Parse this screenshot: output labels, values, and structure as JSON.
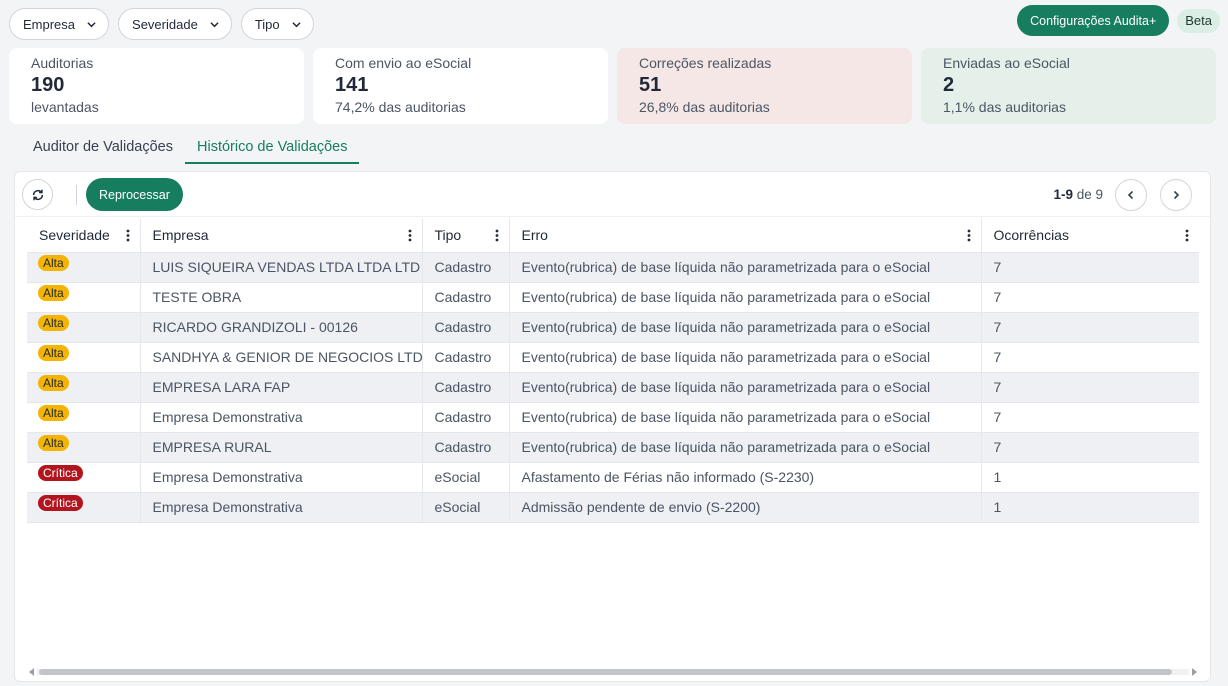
{
  "filters": [
    {
      "label": "Empresa"
    },
    {
      "label": "Severidade"
    },
    {
      "label": "Tipo"
    }
  ],
  "header": {
    "config_button": "Configurações Audita+",
    "beta_label": "Beta"
  },
  "cards": [
    {
      "label": "Auditorias",
      "value": "190",
      "sub": "levantadas"
    },
    {
      "label": "Com envio ao eSocial",
      "value": "141",
      "sub": "74,2% das auditorias"
    },
    {
      "label": "Correções realizadas",
      "value": "51",
      "sub": "26,8% das auditorias"
    },
    {
      "label": "Enviadas ao eSocial",
      "value": "2",
      "sub": "1,1% das auditorias"
    }
  ],
  "tabs": [
    {
      "label": "Auditor de Validações",
      "active": false
    },
    {
      "label": "Histórico de Validações",
      "active": true
    }
  ],
  "toolbar": {
    "reprocess_label": "Reprocessar",
    "pager_range": "1-9",
    "pager_of": "de 9"
  },
  "table": {
    "columns": [
      "Severidade",
      "Empresa",
      "Tipo",
      "Erro",
      "Ocorrências"
    ],
    "rows": [
      {
        "severity": "Alta",
        "company": "LUIS SIQUEIRA VENDAS LTDA LTDA LTD",
        "type": "Cadastro",
        "error": "Evento(rubrica) de base líquida não parametrizada para o eSocial",
        "count": "7"
      },
      {
        "severity": "Alta",
        "company": "TESTE OBRA",
        "type": "Cadastro",
        "error": "Evento(rubrica) de base líquida não parametrizada para o eSocial",
        "count": "7"
      },
      {
        "severity": "Alta",
        "company": "RICARDO GRANDIZOLI - 00126",
        "type": "Cadastro",
        "error": "Evento(rubrica) de base líquida não parametrizada para o eSocial",
        "count": "7"
      },
      {
        "severity": "Alta",
        "company": "SANDHYA & GENIOR DE NEGOCIOS LTDA",
        "type": "Cadastro",
        "error": "Evento(rubrica) de base líquida não parametrizada para o eSocial",
        "count": "7"
      },
      {
        "severity": "Alta",
        "company": "EMPRESA LARA FAP",
        "type": "Cadastro",
        "error": "Evento(rubrica) de base líquida não parametrizada para o eSocial",
        "count": "7"
      },
      {
        "severity": "Alta",
        "company": "Empresa Demonstrativa",
        "type": "Cadastro",
        "error": "Evento(rubrica) de base líquida não parametrizada para o eSocial",
        "count": "7"
      },
      {
        "severity": "Alta",
        "company": "EMPRESA RURAL",
        "type": "Cadastro",
        "error": "Evento(rubrica) de base líquida não parametrizada para o eSocial",
        "count": "7"
      },
      {
        "severity": "Crítica",
        "company": "Empresa Demonstrativa",
        "type": "eSocial",
        "error": "Afastamento de Férias não informado (S-2230)",
        "count": "1"
      },
      {
        "severity": "Crítica",
        "company": "Empresa Demonstrativa",
        "type": "eSocial",
        "error": "Admissão pendente de envio (S-2200)",
        "count": "1"
      }
    ]
  },
  "colors": {
    "accent": "#177d5f",
    "alta": "#f5b400",
    "critica": "#b3151f"
  }
}
